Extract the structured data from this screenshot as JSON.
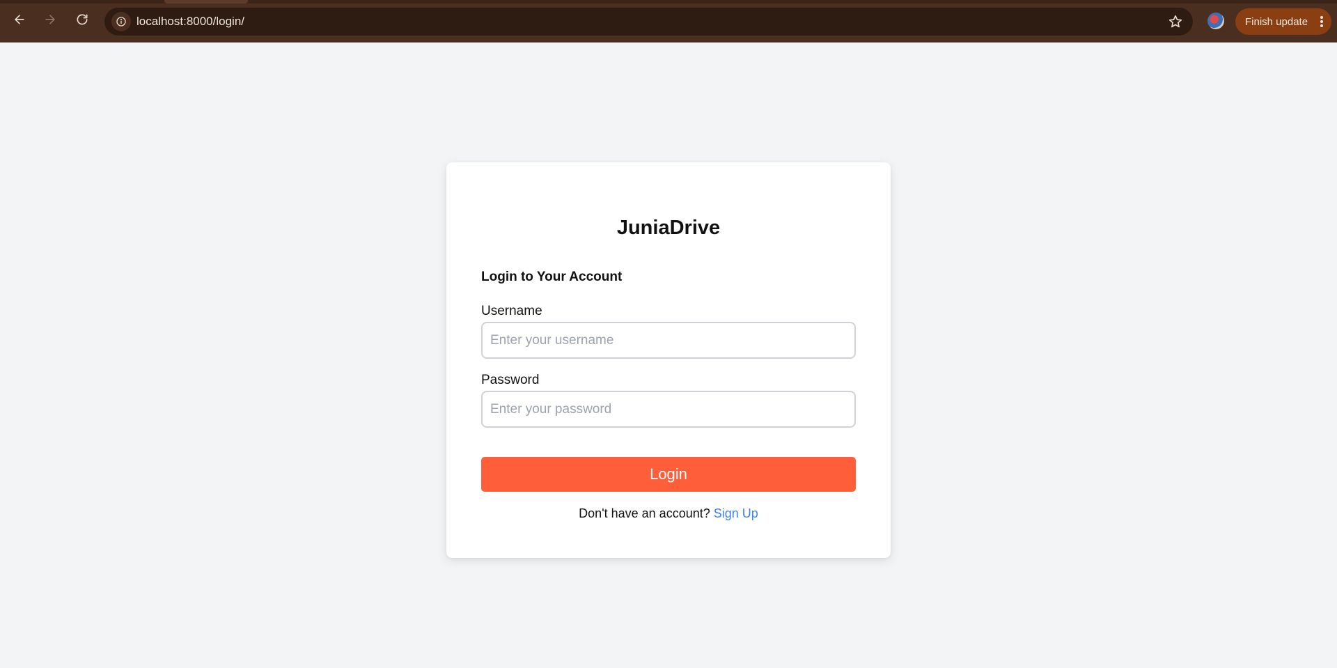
{
  "browser": {
    "url": "localhost:8000/login/",
    "finish_update_label": "Finish update"
  },
  "login": {
    "brand": "JuniaDrive",
    "subtitle": "Login to Your Account",
    "username_label": "Username",
    "username_placeholder": "Enter your username",
    "password_label": "Password",
    "password_placeholder": "Enter your password",
    "submit_label": "Login",
    "signup_prompt": "Don't have an account?",
    "signup_link": "Sign Up"
  },
  "colors": {
    "page_bg": "#f3f4f6",
    "accent": "#ff5e3a",
    "link": "#3b82f6",
    "chrome": "#4a2e1f"
  },
  "icons": [
    "back-arrow-icon",
    "forward-arrow-icon",
    "reload-icon",
    "site-info-icon",
    "star-icon",
    "profile-avatar",
    "more-vert-icon"
  ]
}
